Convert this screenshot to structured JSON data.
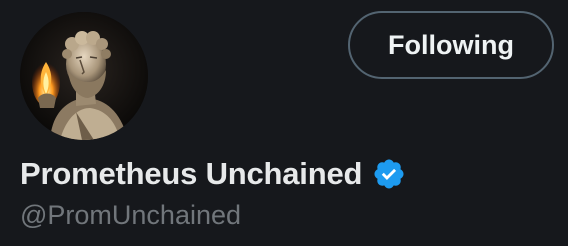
{
  "profile": {
    "display_name": "Prometheus Unchained",
    "handle": "@PromUnchained",
    "verified": true,
    "avatar_description_icon": "bust-with-flame-avatar"
  },
  "actions": {
    "follow_button_label": "Following"
  },
  "colors": {
    "background": "#16181c",
    "name_text": "#e7e9ea",
    "handle_text": "#71767b",
    "button_border": "#536471",
    "verified_badge": "#1d9bf0"
  }
}
